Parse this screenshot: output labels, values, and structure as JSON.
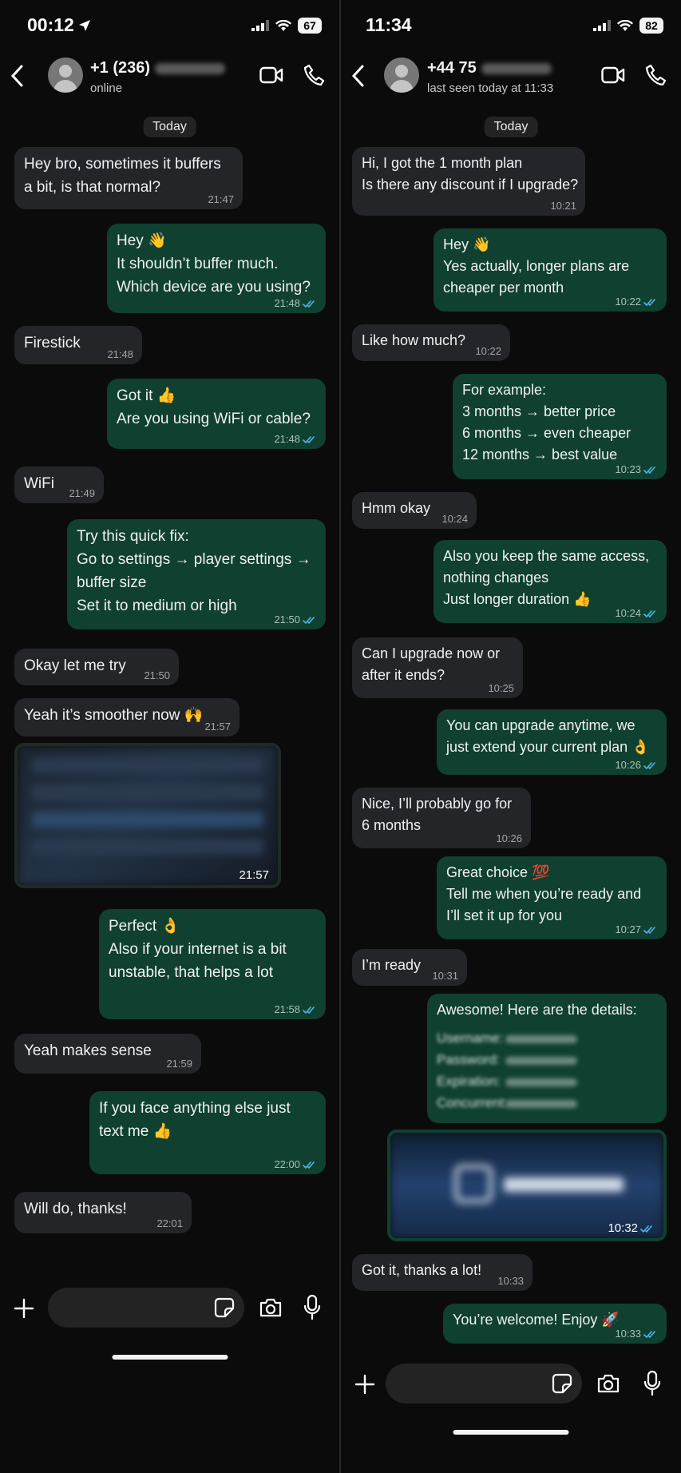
{
  "left": {
    "status": {
      "time": "00:12",
      "battery": "67"
    },
    "header": {
      "contact_name": "+1 (236)",
      "subtitle": "online"
    },
    "day_label": "Today",
    "messages": [
      {
        "lines": [
          "Hey bro, sometimes it buffers",
          "a bit, is that normal?"
        ],
        "time": "21:47"
      },
      {
        "lines": [
          "Hey 👋",
          "It shouldn’t buffer much.",
          "Which device are you using?"
        ],
        "time": "21:48"
      },
      {
        "lines": [
          "Firestick"
        ],
        "time": "21:48"
      },
      {
        "lines": [
          "Got it 👍",
          "Are you using WiFi or cable?"
        ],
        "time": "21:48"
      },
      {
        "lines": [
          "WiFi"
        ],
        "time": "21:49"
      },
      {
        "lines": [
          "Try this quick fix:",
          "Go to settings → player settings →",
          "buffer size",
          "Set it to medium or high"
        ],
        "time": "21:50"
      },
      {
        "lines": [
          "Okay let me try"
        ],
        "time": "21:50"
      },
      {
        "lines": [
          "Yeah it’s smoother now 🙌"
        ],
        "time": "21:57"
      },
      {
        "media_time": "21:57"
      },
      {
        "lines": [
          "Perfect 👌",
          "Also if your internet is a bit",
          "unstable, that helps a lot"
        ],
        "time": "21:58"
      },
      {
        "lines": [
          "Yeah makes sense"
        ],
        "time": "21:59"
      },
      {
        "lines": [
          "If you face anything else just",
          "text me 👍"
        ],
        "time": "22:00"
      },
      {
        "lines": [
          "Will do, thanks!"
        ],
        "time": "22:01"
      }
    ]
  },
  "right": {
    "status": {
      "time": "11:34",
      "battery": "82"
    },
    "header": {
      "contact_name": "+44 75",
      "subtitle": "last seen today at 11:33"
    },
    "day_label": "Today",
    "messages": [
      {
        "lines": [
          "Hi, I got the 1 month plan",
          "Is there any discount if I upgrade?"
        ],
        "time": "10:21"
      },
      {
        "lines": [
          "Hey 👋",
          "Yes actually, longer plans are",
          "cheaper per month"
        ],
        "time": "10:22"
      },
      {
        "lines": [
          "Like how much?"
        ],
        "time": "10:22"
      },
      {
        "lines": [
          "For example:",
          "3 months → better price",
          "6 months → even cheaper",
          "12 months → best value"
        ],
        "time": "10:23"
      },
      {
        "lines": [
          "Hmm okay"
        ],
        "time": "10:24"
      },
      {
        "lines": [
          "Also you keep the same access,",
          "nothing changes",
          "Just longer duration 👍"
        ],
        "time": "10:24"
      },
      {
        "lines": [
          "Can I upgrade now or",
          "after it ends?"
        ],
        "time": "10:25"
      },
      {
        "lines": [
          "You can upgrade anytime, we",
          "just extend your current plan 👌"
        ],
        "time": "10:26"
      },
      {
        "lines": [
          "Nice, I’ll probably go for",
          "6 months"
        ],
        "time": "10:26"
      },
      {
        "lines": [
          "Great choice 💯",
          "Tell me when you’re ready and",
          "I’ll set it up for you"
        ],
        "time": "10:27"
      },
      {
        "lines": [
          "I’m ready"
        ],
        "time": "10:31"
      },
      {
        "lines": [
          "Awesome! Here are the details:"
        ],
        "cred_labels": [
          "Username:",
          "Password:",
          "Expiration:",
          "Concurrent:"
        ]
      },
      {
        "media_time": "10:32"
      },
      {
        "lines": [
          "Got it, thanks a lot!"
        ],
        "time": "10:33"
      },
      {
        "lines": [
          "You’re welcome! Enjoy 🚀"
        ],
        "time": "10:33"
      }
    ]
  },
  "colors": {
    "incoming": "#242528",
    "outgoing": "#0f4030",
    "read_check": "#4fb6ec"
  }
}
